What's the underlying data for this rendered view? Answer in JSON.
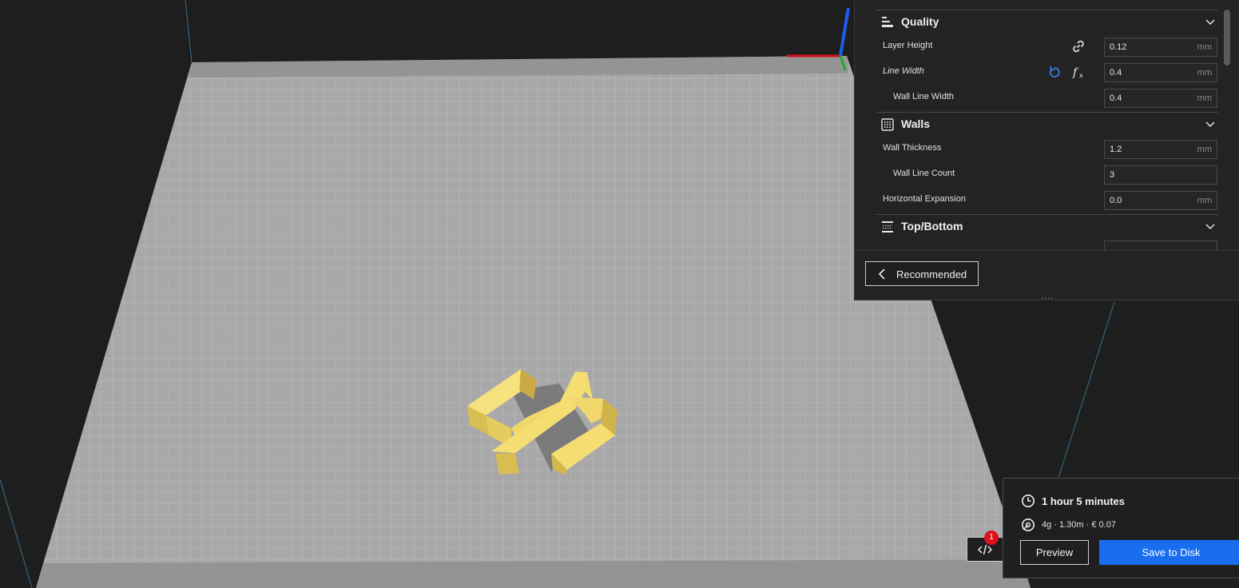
{
  "settings": {
    "categories": [
      {
        "title": "Quality",
        "icon": "quality-icon"
      },
      {
        "title": "Walls",
        "icon": "walls-icon"
      },
      {
        "title": "Top/Bottom",
        "icon": "top-bottom-icon"
      }
    ],
    "quality": {
      "layer_height": {
        "label": "Layer Height",
        "value": "0.12",
        "unit": "mm"
      },
      "line_width": {
        "label": "Line Width",
        "value": "0.4",
        "unit": "mm"
      },
      "wall_line_width": {
        "label": "Wall Line Width",
        "value": "0.4",
        "unit": "mm"
      }
    },
    "walls": {
      "wall_thickness": {
        "label": "Wall Thickness",
        "value": "1.2",
        "unit": "mm"
      },
      "wall_line_count": {
        "label": "Wall Line Count",
        "value": "3"
      },
      "horizontal_expansion": {
        "label": "Horizontal Expansion",
        "value": "0.0",
        "unit": "mm"
      }
    },
    "recommended_label": "Recommended"
  },
  "print_info": {
    "time": "1 hour 5 minutes",
    "material": "4g · 1.30m · € 0.07",
    "preview_label": "Preview",
    "save_label": "Save to Disk"
  },
  "notification_count": "1",
  "colors": {
    "accent": "#196ef0",
    "model": "#f5d76e",
    "badge": "#e0101a"
  }
}
